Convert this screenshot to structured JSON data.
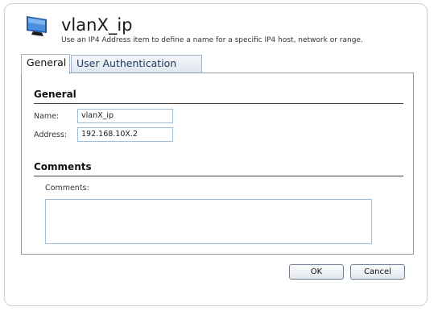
{
  "header": {
    "title": "vlanX_ip",
    "subtitle": "Use an IP4 Address item to define a name for a specific IP4 host, network or range.",
    "icon": "monitor-icon"
  },
  "tabs": [
    {
      "label": "General",
      "selected": true
    },
    {
      "label": "User Authentication",
      "selected": false
    }
  ],
  "general": {
    "heading": "General",
    "name_label": "Name:",
    "name_value": "vlanX_ip",
    "address_label": "Address:",
    "address_value": "192.168.10X.2"
  },
  "comments": {
    "heading": "Comments",
    "label": "Comments:",
    "value": ""
  },
  "footer": {
    "ok_label": "OK",
    "cancel_label": "Cancel"
  }
}
